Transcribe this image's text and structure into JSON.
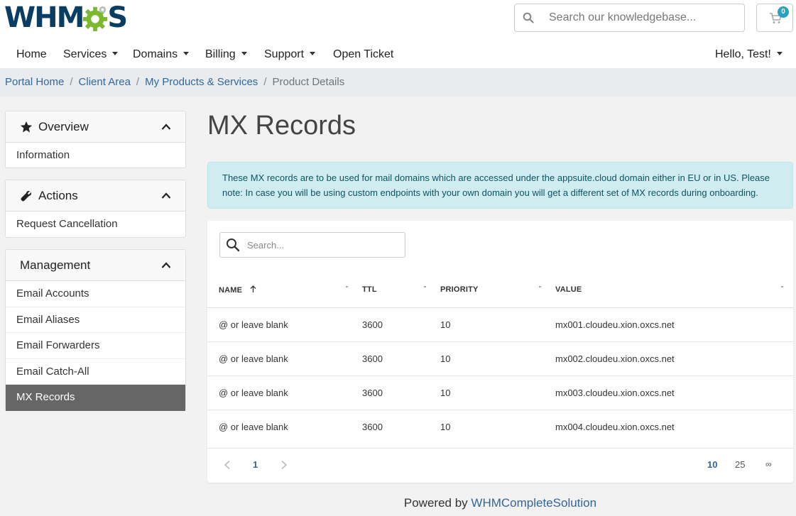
{
  "logo": {
    "text_before": "WHM",
    "text_after": "S"
  },
  "header": {
    "search_placeholder": "Search our knowledgebase...",
    "cart_count": "0"
  },
  "nav": {
    "home": "Home",
    "services": "Services",
    "domains": "Domains",
    "billing": "Billing",
    "support": "Support",
    "open_ticket": "Open Ticket",
    "user": "Hello, Test!"
  },
  "breadcrumb": {
    "portal_home": "Portal Home",
    "client_area": "Client Area",
    "products": "My Products & Services",
    "current": "Product Details"
  },
  "sidebar": {
    "overview": {
      "title": "Overview",
      "items": [
        {
          "label": "Information"
        }
      ]
    },
    "actions": {
      "title": "Actions",
      "items": [
        {
          "label": "Request Cancellation"
        }
      ]
    },
    "management": {
      "title": "Management",
      "items": [
        {
          "label": "Email Accounts"
        },
        {
          "label": "Email Aliases"
        },
        {
          "label": "Email Forwarders"
        },
        {
          "label": "Email Catch-All"
        },
        {
          "label": "MX Records"
        }
      ]
    }
  },
  "main": {
    "title": "MX Records",
    "alert": "These MX records are to be used for mail domains which are accessed under the appsuite.cloud domain either in EU or in US. Please note: In case you will be using custom endpoints with your own domain you will get a different set of MX records during onboarding.",
    "table": {
      "search_placeholder": "Search...",
      "columns": [
        "NAME",
        "TTL",
        "PRIORITY",
        "VALUE"
      ],
      "rows": [
        [
          "@ or leave blank",
          "3600",
          "10",
          "mx001.cloudeu.xion.oxcs.net"
        ],
        [
          "@ or leave blank",
          "3600",
          "10",
          "mx002.cloudeu.xion.oxcs.net"
        ],
        [
          "@ or leave blank",
          "3600",
          "10",
          "mx003.cloudeu.xion.oxcs.net"
        ],
        [
          "@ or leave blank",
          "3600",
          "10",
          "mx004.cloudeu.xion.oxcs.net"
        ]
      ],
      "current_page": "1",
      "page_sizes": [
        "10",
        "25",
        "∞"
      ]
    }
  },
  "footer": {
    "prefix": "Powered by",
    "link": "WHMCompleteSolution"
  },
  "colors": {
    "accent": "#336699",
    "logo_navy": "#0a3d62",
    "logo_green": "#7cb82f",
    "badge": "#2aa1c0",
    "alert_bg": "#d1ecf1",
    "active_item": "#666666"
  }
}
